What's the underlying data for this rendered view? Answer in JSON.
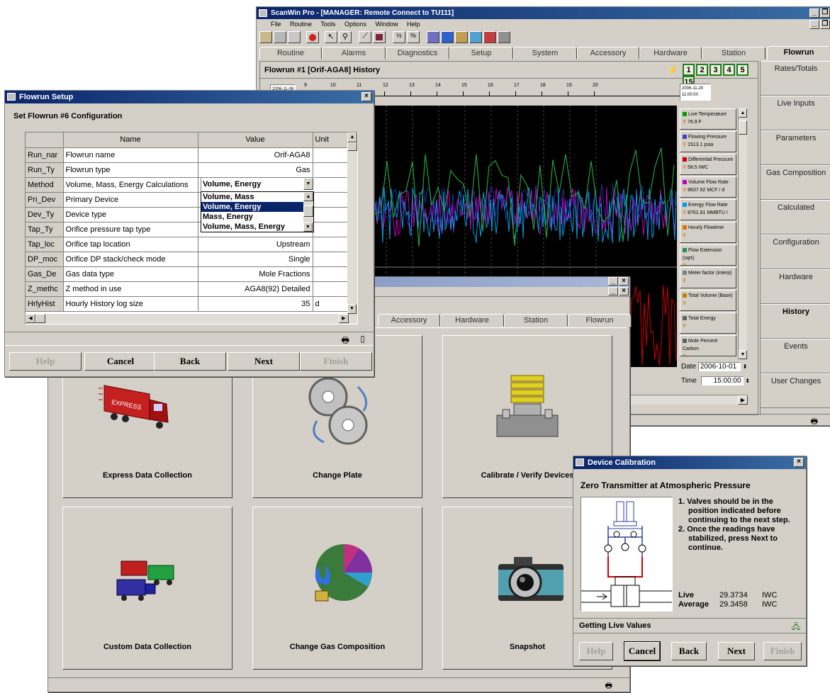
{
  "main_window": {
    "title": "ScanWin Pro - [MANAGER: Remote Connect to TU111]",
    "menu": [
      "File",
      "Routine",
      "Tools",
      "Options",
      "Window",
      "Help"
    ],
    "tabs": [
      "Routine",
      "Alarms",
      "Diagnostics",
      "Setup",
      "System",
      "Accessory",
      "Hardware",
      "Station",
      "Flowrun"
    ],
    "active_tab": "Flowrun",
    "history": {
      "title": "Flowrun #1 [Orif-AGA8] History",
      "run_buttons": [
        "1",
        "2",
        "3",
        "4",
        "5",
        "15"
      ],
      "axis_start": "2006-11-06",
      "axis_end_date": "2006-11-20",
      "axis_end_time": "11:00:00",
      "ticks": [
        "9",
        "10",
        "11",
        "12",
        "13",
        "14",
        "15",
        "16",
        "17",
        "18",
        "19",
        "20"
      ],
      "channels": [
        {
          "name": "Live Temperature",
          "value": "76.9 F",
          "color": "#00a000"
        },
        {
          "name": "Flowing Pressure",
          "value": "1513.1 psia",
          "color": "#4040c0"
        },
        {
          "name": "Differential Pressure",
          "value": "58.5 IWC",
          "color": "#d00000"
        },
        {
          "name": "Volume Flow Rate",
          "value": "8637.92 MCF / d",
          "color": "#c000c0"
        },
        {
          "name": "Energy Flow Rate",
          "value": "8761.81 MMBTU /",
          "color": "#00a0e0"
        },
        {
          "name": "Hourly Flowtime",
          "value": "",
          "color": "#e07000"
        },
        {
          "name": "Flow Extension (sqrt)",
          "value": "",
          "color": "#209060"
        },
        {
          "name": "Meter factor (interp)",
          "value": "",
          "color": "#808080"
        },
        {
          "name": "Total Volume (Base)",
          "value": "",
          "color": "#c08000"
        },
        {
          "name": "Total Energy",
          "value": "",
          "color": "#606060"
        },
        {
          "name": "Mole Percent Carbon",
          "value": "",
          "color": "#606060"
        }
      ],
      "date_label": "Date",
      "date_value": "2006-10-01",
      "time_label": "Time",
      "time_value": "15:00:00"
    },
    "sidebar": [
      "Rates/Totals",
      "Live Inputs",
      "Parameters",
      "Gas Composition",
      "Calculated",
      "Configuration",
      "Hardware",
      "History",
      "Events",
      "User Changes"
    ],
    "sidebar_active": "History"
  },
  "tasks_window": {
    "tabs": [
      "Accessory",
      "Hardware",
      "Station",
      "Flowrun"
    ],
    "tiles": [
      {
        "label": "Express Data Collection",
        "icon": "truck-icon",
        "truck_text": "EXPRESS"
      },
      {
        "label": "Change Plate",
        "icon": "plates-icon"
      },
      {
        "label": "Calibrate / Verify Devices",
        "icon": "transmitter-icon"
      },
      {
        "label": "Custom Data Collection",
        "icon": "trucks-icon"
      },
      {
        "label": "Change Gas Composition",
        "icon": "gas-pie-icon"
      },
      {
        "label": "Snapshot",
        "icon": "camera-icon"
      }
    ]
  },
  "setup_dialog": {
    "title": "Flowrun Setup",
    "heading": "Set Flowrun #6 Configuration",
    "columns": [
      "Name",
      "Value",
      "Unit"
    ],
    "rows": [
      {
        "code": "Run_nar",
        "name": "Flowrun name",
        "value": "Orif-AGA8",
        "unit": ""
      },
      {
        "code": "Run_Ty",
        "name": "Flowrun type",
        "value": "Gas",
        "unit": ""
      },
      {
        "code": "Method",
        "name": "Volume, Mass, Energy Calculations",
        "value": "Volume, Energy",
        "unit": ""
      },
      {
        "code": "Pri_Dev",
        "name": "Primary Device",
        "value": "",
        "unit": ""
      },
      {
        "code": "Dev_Ty",
        "name": "Device type",
        "value": "",
        "unit": ""
      },
      {
        "code": "Tap_Ty",
        "name": "Orifice pressure tap type",
        "value": "",
        "unit": ""
      },
      {
        "code": "Tap_loc",
        "name": "Orifice tap location",
        "value": "Upstream",
        "unit": ""
      },
      {
        "code": "DP_moc",
        "name": "Orifice DP stack/check mode",
        "value": "Single",
        "unit": ""
      },
      {
        "code": "Gas_De",
        "name": "Gas data type",
        "value": "Mole Fractions",
        "unit": ""
      },
      {
        "code": "Z_methc",
        "name": "Z method in use",
        "value": "AGA8(92) Detailed",
        "unit": ""
      },
      {
        "code": "HrlyHist",
        "name": "Hourly History log size",
        "value": "35",
        "unit": "d"
      }
    ],
    "dropdown_options": [
      "Volume, Mass",
      "Volume, Energy",
      "Mass, Energy",
      "Volume, Mass, Energy"
    ],
    "dropdown_selected": "Volume, Energy",
    "buttons": {
      "help": "Help",
      "cancel": "Cancel",
      "back": "Back",
      "next": "Next",
      "finish": "Finish"
    }
  },
  "calibration_dialog": {
    "title": "Device Calibration",
    "heading": "Zero Transmitter at Atmospheric Pressure",
    "steps": [
      "1. Valves should be in the position indicated before continuing to the next step.",
      "2. Once the readings have stabilized, press Next to continue."
    ],
    "live_label": "Live",
    "live_value": "29.3734",
    "live_unit": "IWC",
    "avg_label": "Average",
    "avg_value": "29.3458",
    "avg_unit": "IWC",
    "status": "Getting Live Values",
    "buttons": {
      "help": "Help",
      "cancel": "Cancel",
      "back": "Back",
      "next": "Next",
      "finish": "Finish"
    }
  },
  "colors": {
    "titlebar": "#0a246a",
    "face": "#d4d0c8",
    "chart_bg": "#000000"
  }
}
